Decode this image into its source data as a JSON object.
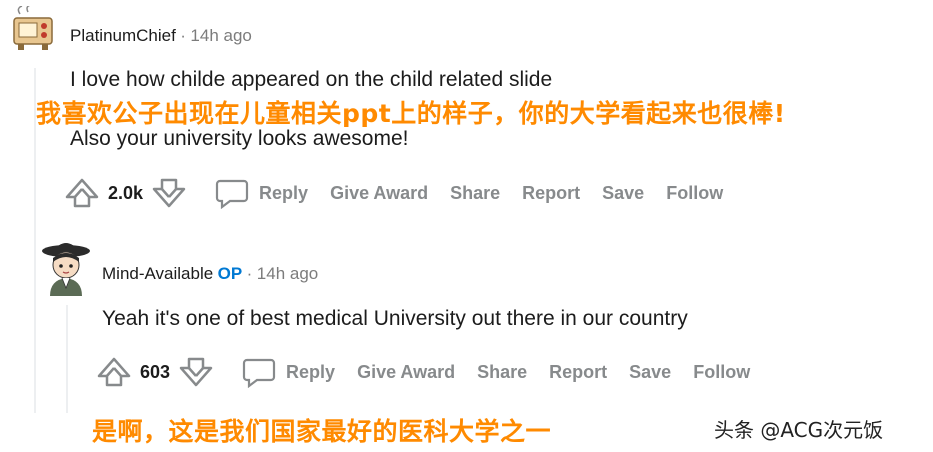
{
  "comment1": {
    "username": "PlatinumChief",
    "separator": "·",
    "time": "14h ago",
    "text": "I love how childe appeared on the child related slide",
    "text2": "Also your university looks awesome!",
    "overlay_cn": "我喜欢公子出现在儿童相关ppt上的样子，你的大学看起来也很棒!",
    "score": "2.0k",
    "actions": {
      "reply": "Reply",
      "give_award": "Give Award",
      "share": "Share",
      "report": "Report",
      "save": "Save",
      "follow": "Follow"
    }
  },
  "comment2": {
    "username": "Mind-Available",
    "op_badge": "OP",
    "separator": "·",
    "time": "14h ago",
    "text": "Yeah it's one of best medical University out there in our country",
    "overlay_cn": "是啊，这是我们国家最好的医科大学之一",
    "score": "603",
    "actions": {
      "reply": "Reply",
      "give_award": "Give Award",
      "share": "Share",
      "report": "Report",
      "save": "Save",
      "follow": "Follow"
    }
  },
  "watermark": "头条 @ACG次元饭",
  "colors": {
    "overlay": "#ff8a00",
    "op": "#0079d3",
    "muted": "#878a8c",
    "upvote_icon": "#878a8c"
  }
}
